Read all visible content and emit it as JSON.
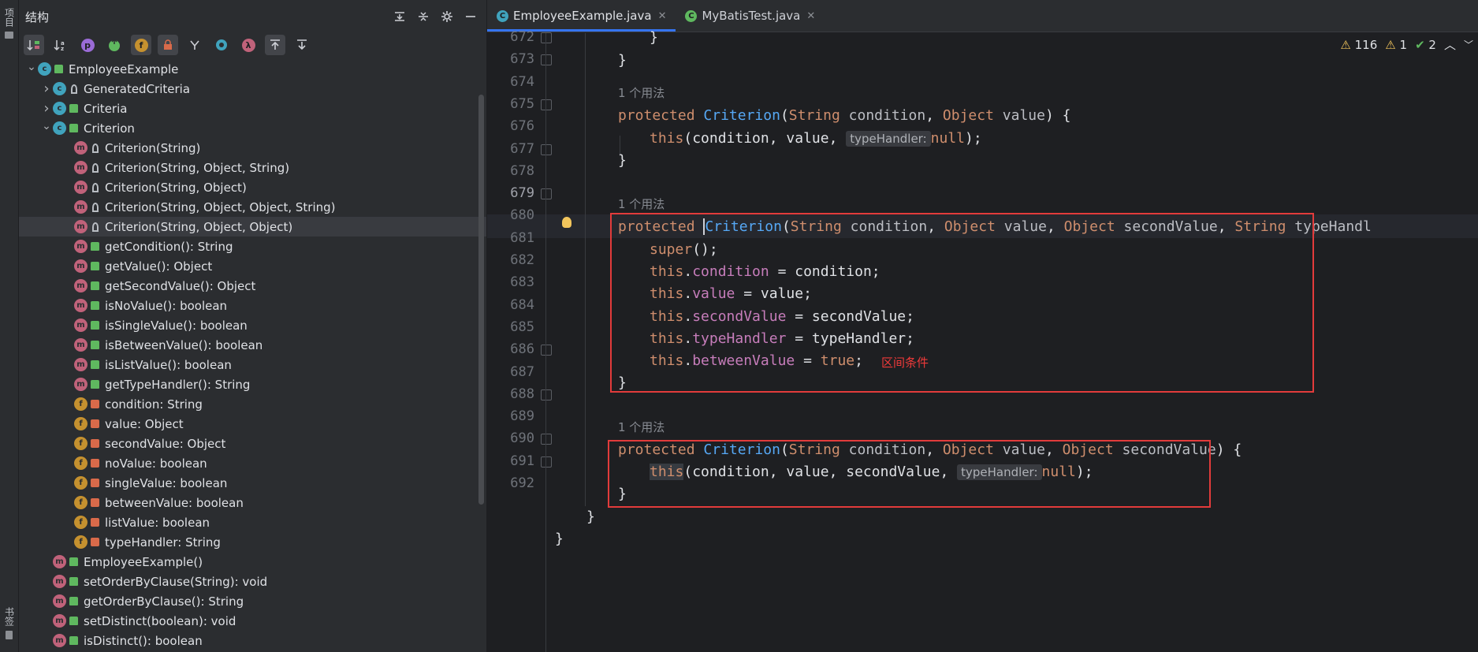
{
  "side_strip": {
    "top_tab": "项目",
    "bottom_tab": "书签"
  },
  "structure": {
    "title": "结构",
    "toolbar_letters": [
      "p",
      "f",
      "λ"
    ],
    "tree": [
      {
        "label": "EmployeeExample",
        "icon": "C",
        "vis": "pub",
        "level": 0,
        "arrow": "down"
      },
      {
        "label": "GeneratedCriteria",
        "icon": "C",
        "vis": "pkg",
        "level": 1,
        "arrow": "right"
      },
      {
        "label": "Criteria",
        "icon": "C",
        "vis": "pub",
        "level": 1,
        "arrow": "right"
      },
      {
        "label": "Criterion",
        "icon": "C",
        "vis": "pub",
        "level": 1,
        "arrow": "down"
      },
      {
        "label": "Criterion(String)",
        "icon": "m",
        "vis": "pkg",
        "level": 2
      },
      {
        "label": "Criterion(String, Object, String)",
        "icon": "m",
        "vis": "pkg",
        "level": 2
      },
      {
        "label": "Criterion(String, Object)",
        "icon": "m",
        "vis": "pkg",
        "level": 2
      },
      {
        "label": "Criterion(String, Object, Object, String)",
        "icon": "m",
        "vis": "pkg",
        "level": 2
      },
      {
        "label": "Criterion(String, Object, Object)",
        "icon": "m",
        "vis": "pkg",
        "level": 2,
        "selected": true
      },
      {
        "label": "getCondition(): String",
        "icon": "m",
        "vis": "pub",
        "level": 2
      },
      {
        "label": "getValue(): Object",
        "icon": "m",
        "vis": "pub",
        "level": 2
      },
      {
        "label": "getSecondValue(): Object",
        "icon": "m",
        "vis": "pub",
        "level": 2
      },
      {
        "label": "isNoValue(): boolean",
        "icon": "m",
        "vis": "pub",
        "level": 2
      },
      {
        "label": "isSingleValue(): boolean",
        "icon": "m",
        "vis": "pub",
        "level": 2
      },
      {
        "label": "isBetweenValue(): boolean",
        "icon": "m",
        "vis": "pub",
        "level": 2
      },
      {
        "label": "isListValue(): boolean",
        "icon": "m",
        "vis": "pub",
        "level": 2
      },
      {
        "label": "getTypeHandler(): String",
        "icon": "m",
        "vis": "pub",
        "level": 2
      },
      {
        "label": "condition: String",
        "icon": "f",
        "vis": "priv",
        "level": 2
      },
      {
        "label": "value: Object",
        "icon": "f",
        "vis": "priv",
        "level": 2
      },
      {
        "label": "secondValue: Object",
        "icon": "f",
        "vis": "priv",
        "level": 2
      },
      {
        "label": "noValue: boolean",
        "icon": "f",
        "vis": "priv",
        "level": 2
      },
      {
        "label": "singleValue: boolean",
        "icon": "f",
        "vis": "priv",
        "level": 2
      },
      {
        "label": "betweenValue: boolean",
        "icon": "f",
        "vis": "priv",
        "level": 2
      },
      {
        "label": "listValue: boolean",
        "icon": "f",
        "vis": "priv",
        "level": 2
      },
      {
        "label": "typeHandler: String",
        "icon": "f",
        "vis": "priv",
        "level": 2
      },
      {
        "label": "EmployeeExample()",
        "icon": "m",
        "vis": "pub",
        "level": 1
      },
      {
        "label": "setOrderByClause(String): void",
        "icon": "m",
        "vis": "pub",
        "level": 1
      },
      {
        "label": "getOrderByClause(): String",
        "icon": "m",
        "vis": "pub",
        "level": 1
      },
      {
        "label": "setDistinct(boolean): void",
        "icon": "m",
        "vis": "pub",
        "level": 1
      },
      {
        "label": "isDistinct(): boolean",
        "icon": "m",
        "vis": "pub",
        "level": 1
      }
    ]
  },
  "editor": {
    "tabs": [
      {
        "label": "EmployeeExample.java",
        "active": true
      },
      {
        "label": "MyBatisTest.java",
        "active": false
      }
    ],
    "inspections": {
      "warnings": "116",
      "weak_warnings": "1",
      "ok": "2"
    },
    "usage_hint": "1 个用法",
    "inlay_type_handler": "typeHandler:",
    "annotation": "区间条件",
    "line_numbers": [
      "672",
      "673",
      "674",
      "675",
      "676",
      "677",
      "678",
      "679",
      "680",
      "681",
      "682",
      "683",
      "684",
      "685",
      "686",
      "687",
      "688",
      "689",
      "690",
      "691",
      "692"
    ],
    "code": {
      "l672": "}",
      "l673": "}",
      "l675": [
        "protected",
        "Criterion",
        "(",
        "String",
        "condition",
        ", ",
        "Object",
        "value",
        ") {"
      ],
      "l676": [
        "this",
        "(condition, value, ",
        "null",
        ");"
      ],
      "l677": "}",
      "l679": [
        "protected",
        "Criterion",
        "(",
        "String",
        "condition",
        ", ",
        "Object",
        "value",
        ", ",
        "Object",
        "secondValue",
        ", ",
        "String",
        "typeHandl"
      ],
      "l680": [
        "super",
        "();"
      ],
      "l681": [
        "this",
        ".",
        "condition",
        " = condition;"
      ],
      "l682": [
        "this",
        ".",
        "value",
        " = value;"
      ],
      "l683": [
        "this",
        ".",
        "secondValue",
        " = secondValue;"
      ],
      "l684": [
        "this",
        ".",
        "typeHandler",
        " = typeHandler;"
      ],
      "l685": [
        "this",
        ".",
        "betweenValue",
        " = ",
        "true",
        ";"
      ],
      "l686": "}",
      "l688": [
        "protected",
        "Criterion",
        "(",
        "String",
        "condition",
        ", ",
        "Object",
        "value",
        ", ",
        "Object",
        "secondValue",
        ") {"
      ],
      "l689": [
        "this",
        "(condition, value, secondValue, ",
        "null",
        ");"
      ],
      "l690": "}",
      "l691": "}",
      "l692": "}"
    },
    "colors": {
      "keyword": "#cf8e6d",
      "method": "#56a8f5",
      "field": "#c77dbb",
      "highlight_box": "#e23b3b",
      "accent": "#3574f0"
    }
  }
}
